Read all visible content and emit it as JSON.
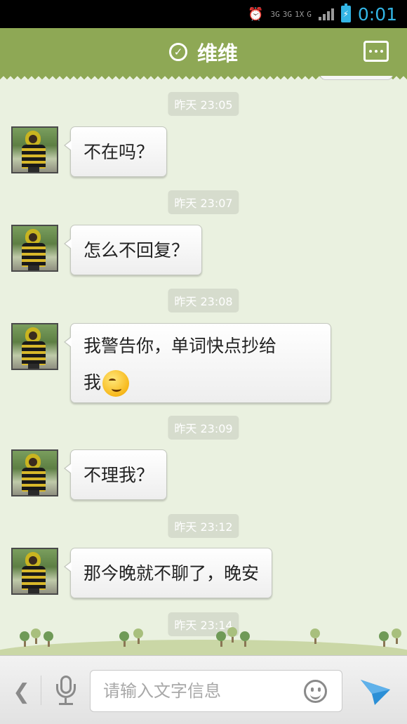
{
  "status_bar": {
    "network_labels": [
      "3G",
      "3G",
      "1X",
      "G"
    ],
    "time": "0:01",
    "battery_icon": "battery-charging-icon",
    "alarm_icon": "alarm-clock-icon"
  },
  "header": {
    "title": "维维",
    "verified_icon": "check-circle-icon",
    "menu_icon": "more-menu-icon"
  },
  "messages": [
    {
      "time": "昨天 23:05",
      "text": "不在吗？"
    },
    {
      "time": "昨天 23:07",
      "text": "怎么不回复？"
    },
    {
      "time": "昨天 23:08",
      "text_line1": "我警告你，单词快点抄给",
      "text_line2": "我",
      "emoji": "grin-emoji-icon"
    },
    {
      "time": "昨天 23:09",
      "text": "不理我？"
    },
    {
      "time": "昨天 23:12",
      "text": "那今晚就不聊了，晚安"
    },
    {
      "time": "昨天 23:14"
    }
  ],
  "input_bar": {
    "placeholder": "请输入文字信息",
    "back_icon": "chevron-left-icon",
    "voice_icon": "microphone-icon",
    "emoji_icon": "smiley-icon",
    "send_icon": "send-icon"
  },
  "colors": {
    "header_green": "#8ea855",
    "chat_background": "#eaf1e0",
    "status_accent": "#33b5e5",
    "send_blue": "#2b8fd6"
  }
}
